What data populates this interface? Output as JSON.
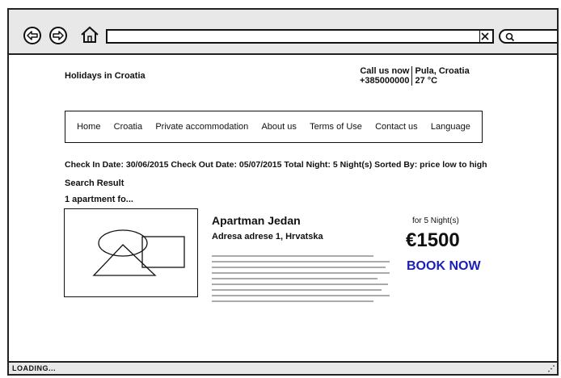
{
  "browser": {
    "back_icon": "back-arrow-icon",
    "forward_icon": "forward-arrow-icon",
    "home_icon": "home-icon",
    "url_value": "",
    "url_clear_label": "X",
    "search_value": "",
    "status_text": "LOADING...",
    "resize_grip": "⋰"
  },
  "header": {
    "site_title": "Holidays in Croatia",
    "call_us": "Call us now",
    "phone": "+385000000",
    "location": "Pula, Croatia",
    "temperature": "27 °C"
  },
  "menu": {
    "items": [
      {
        "label": "Home"
      },
      {
        "label": "Croatia"
      },
      {
        "label": "Private accommodation"
      },
      {
        "label": "About us"
      },
      {
        "label": "Terms of Use"
      },
      {
        "label": "Contact us"
      },
      {
        "label": "Language"
      }
    ]
  },
  "search": {
    "info": "Check In Date: 30/06/2015 Check Out Date: 05/07/2015 Total Night: 5 Night(s) Sorted By: price low to high",
    "heading": "Search Result",
    "count_text": "1 apartment fo..."
  },
  "listing": {
    "name": "Apartman Jedan",
    "address": "Adresa adrese 1, Hrvatska",
    "nights_label": "for 5 Night(s)",
    "price": "€1500",
    "book_label": "BOOK NOW",
    "book_color": "#1a1fb5"
  }
}
